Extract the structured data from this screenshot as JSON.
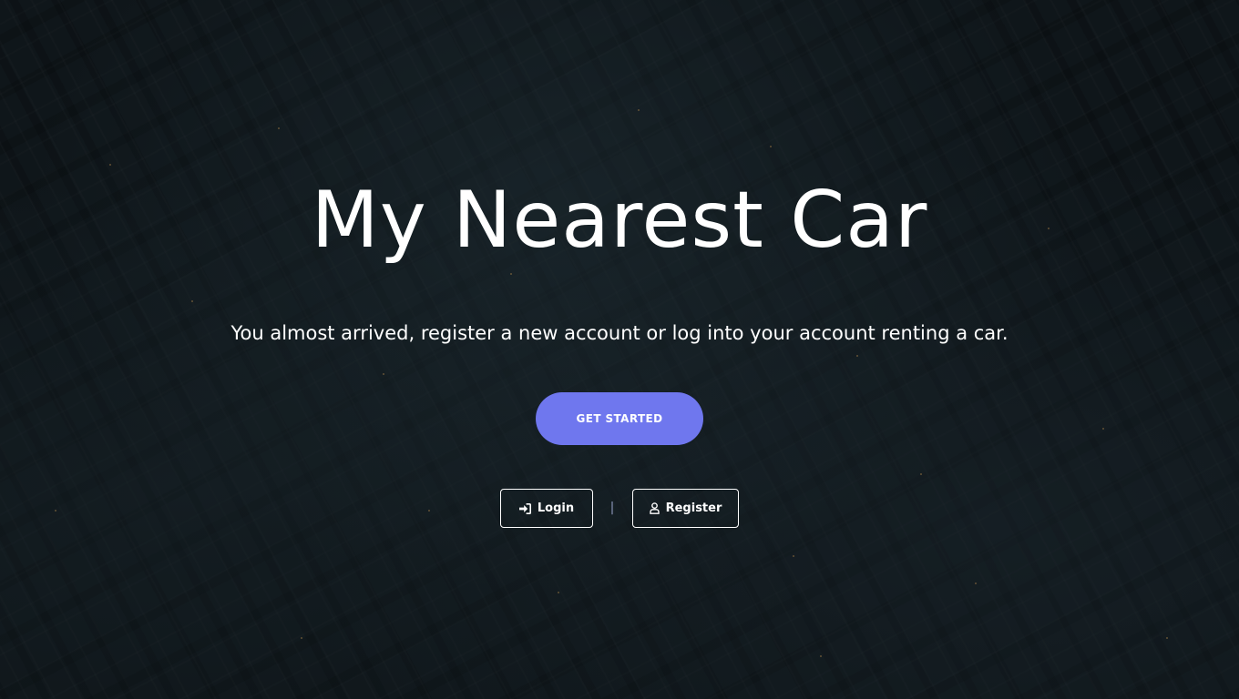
{
  "hero": {
    "title": "My Nearest Car",
    "subtitle": "You almost arrived, register a new account or log into your account renting a car.",
    "cta_label": "GET STARTED",
    "divider": "|"
  },
  "auth": {
    "login": {
      "label": "Login",
      "icon": "sign-in-icon"
    },
    "register": {
      "label": "Register",
      "icon": "user-icon"
    }
  },
  "colors": {
    "background": "#121a1e",
    "accent": "#6f77ee",
    "text": "#ffffff"
  }
}
